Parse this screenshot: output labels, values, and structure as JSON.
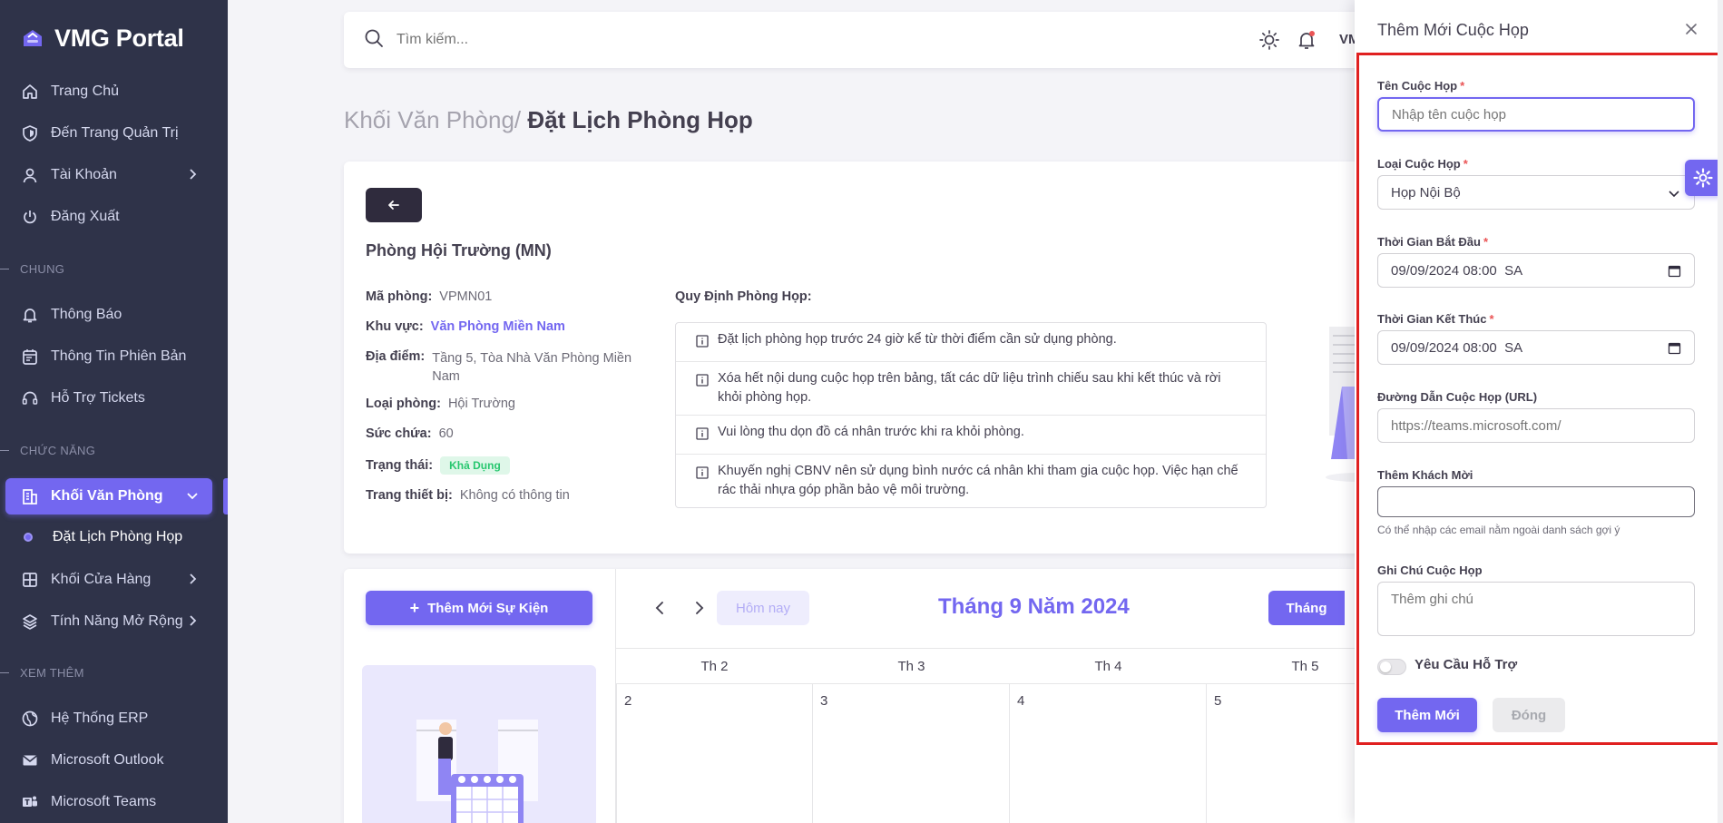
{
  "brand": {
    "name": "VMG Portal"
  },
  "sidebar": {
    "items": [
      {
        "label": "Trang Chủ"
      },
      {
        "label": "Đến Trang Quản Trị"
      },
      {
        "label": "Tài Khoản"
      },
      {
        "label": "Đăng Xuất"
      }
    ],
    "section_chung": "CHUNG",
    "chung_items": [
      {
        "label": "Thông Báo"
      },
      {
        "label": "Thông Tin Phiên Bản"
      },
      {
        "label": "Hỗ Trợ Tickets"
      }
    ],
    "section_chuc_nang": "CHỨC NĂNG",
    "chuc_nang_items": [
      {
        "label": "Khối Văn Phòng"
      },
      {
        "label": "Đặt Lịch Phòng Họp"
      },
      {
        "label": "Khối Cửa Hàng"
      },
      {
        "label": "Tính Năng Mở Rộng"
      }
    ],
    "section_xem_them": "XEM THÊM",
    "xem_them_items": [
      {
        "label": "Hệ Thống ERP"
      },
      {
        "label": "Microsoft Outlook"
      },
      {
        "label": "Microsoft Teams"
      }
    ]
  },
  "topbar": {
    "search_placeholder": "Tìm kiếm...",
    "user_abbr": "VM"
  },
  "page": {
    "breadcrumb": "Khối Văn Phòng/",
    "title": "Đặt Lịch Phòng Họp"
  },
  "room": {
    "name": "Phòng Hội Trường (MN)",
    "code_label": "Mã phòng:",
    "code": "VPMN01",
    "area_label": "Khu vực:",
    "area": "Văn Phòng Miền Nam",
    "location_label": "Địa điểm:",
    "location": "Tầng 5, Tòa Nhà Văn Phòng Miền Nam",
    "type_label": "Loại phòng:",
    "type": "Hội Trường",
    "capacity_label": "Sức chứa:",
    "capacity": "60",
    "status_label": "Trạng thái:",
    "status": "Khả Dụng",
    "equipment_label": "Trang thiết bị:",
    "equipment": "Không có thông tin",
    "rules_title": "Quy Định Phòng Họp:",
    "rules": [
      "Đặt lịch phòng họp trước 24 giờ kể từ thời điểm cần sử dụng phòng.",
      "Xóa hết nội dung cuộc họp trên bảng, tất các dữ liệu trình chiếu sau khi kết thúc và rời khỏi phòng họp.",
      "Vui lòng thu dọn đồ cá nhân trước khi ra khỏi phòng.",
      "Khuyến nghị CBNV nên sử dụng bình nước cá nhân khi tham gia cuộc họp. Việc hạn chế rác thải nhựa góp phần bảo vệ môi trường."
    ]
  },
  "calendar": {
    "add_event_label": "Thêm Mới Sự Kiện",
    "today_label": "Hôm nay",
    "month_title": "Tháng 9 Năm 2024",
    "view_month_label": "Tháng",
    "weekdays": [
      "Th 2",
      "Th 3",
      "Th 4",
      "Th 5"
    ],
    "days": [
      "2",
      "3",
      "4",
      "5"
    ]
  },
  "drawer": {
    "title": "Thêm Mới Cuộc Họp",
    "name_label": "Tên Cuộc Họp",
    "name_placeholder": "Nhập tên cuộc họp",
    "type_label": "Loại Cuộc Họp",
    "type_value": "Họp Nội Bộ",
    "start_label": "Thời Gian Bắt Đầu",
    "start_value": "09/09/2024 08:00  SA",
    "end_label": "Thời Gian Kết Thúc",
    "end_value": "09/09/2024 08:00  SA",
    "url_label": "Đường Dẫn Cuộc Họp (URL)",
    "url_placeholder": "https://teams.microsoft.com/",
    "guests_label": "Thêm Khách Mời",
    "guests_hint": "Có thể nhập các email nằm ngoài danh sách gợi ý",
    "note_label": "Ghi Chú Cuộc Họp",
    "note_placeholder": "Thêm ghi chú",
    "support_label": "Yêu Cầu Hỗ Trợ",
    "submit_label": "Thêm Mới",
    "close_label": "Đóng"
  },
  "colors": {
    "primary": "#7367f0",
    "sidebar": "#2f3349",
    "success": "#28c76f",
    "highlight_frame": "#e02020"
  }
}
